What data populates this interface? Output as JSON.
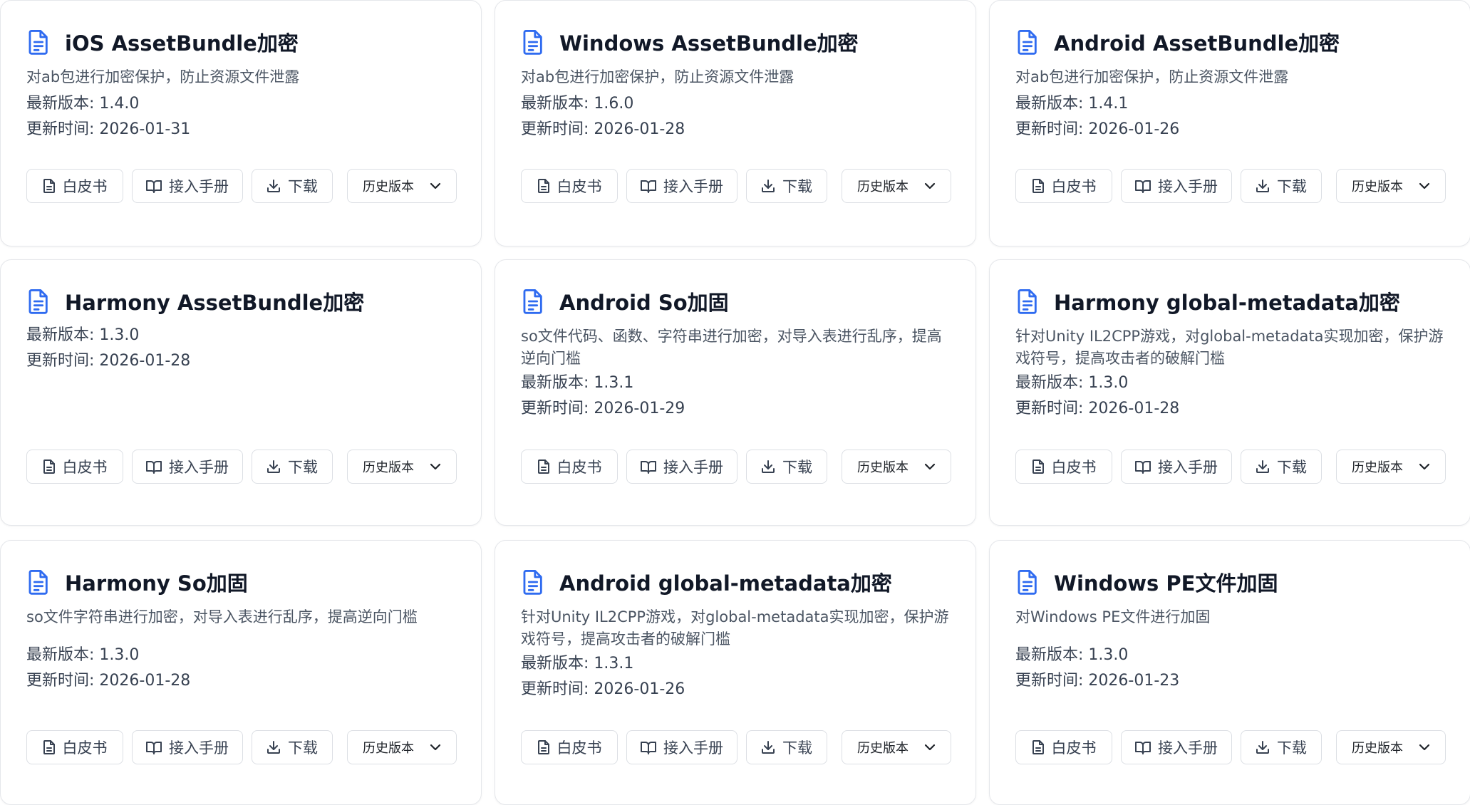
{
  "labels": {
    "version_prefix": "最新版本: ",
    "updated_prefix": "更新时间: ",
    "whitepaper": "白皮书",
    "manual": "接入手册",
    "download": "下载",
    "history": "历史版本"
  },
  "accent_color": "#2f6bf0",
  "cards": [
    {
      "title": "iOS AssetBundle加密",
      "description": "对ab包进行加密保护，防止资源文件泄露",
      "version": "1.4.0",
      "updated": "2026-01-31"
    },
    {
      "title": "Windows AssetBundle加密",
      "description": "对ab包进行加密保护，防止资源文件泄露",
      "version": "1.6.0",
      "updated": "2026-01-28"
    },
    {
      "title": "Android AssetBundle加密",
      "description": "对ab包进行加密保护，防止资源文件泄露",
      "version": "1.4.1",
      "updated": "2026-01-26"
    },
    {
      "title": "Harmony AssetBundle加密",
      "description": "",
      "version": "1.3.0",
      "updated": "2026-01-28"
    },
    {
      "title": "Android So加固",
      "description": "so文件代码、函数、字符串进行加密，对导入表进行乱序，提高逆向门槛",
      "version": "1.3.1",
      "updated": "2026-01-29"
    },
    {
      "title": "Harmony global-metadata加密",
      "description": "针对Unity IL2CPP游戏，对global-metadata实现加密，保护游戏符号，提高攻击者的破解门槛",
      "version": "1.3.0",
      "updated": "2026-01-28"
    },
    {
      "title": "Harmony So加固",
      "description": "so文件字符串进行加密，对导入表进行乱序，提高逆向门槛",
      "version": "1.3.0",
      "updated": "2026-01-28"
    },
    {
      "title": "Android global-metadata加密",
      "description": "针对Unity IL2CPP游戏，对global-metadata实现加密，保护游戏符号，提高攻击者的破解门槛",
      "version": "1.3.1",
      "updated": "2026-01-26"
    },
    {
      "title": "Windows PE文件加固",
      "description": "对Windows PE文件进行加固",
      "version": "1.3.0",
      "updated": "2026-01-23"
    }
  ]
}
